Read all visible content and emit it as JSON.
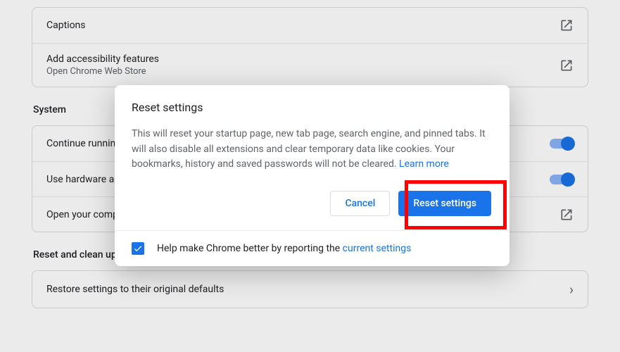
{
  "accessibility": {
    "captions_label": "Captions",
    "addfeat_label": "Add accessibility features",
    "addfeat_sub": "Open Chrome Web Store"
  },
  "system": {
    "section_title": "System",
    "continue_label": "Continue running background apps when Chrome is closed",
    "hardware_label": "Use hardware acceleration when available",
    "proxy_label": "Open your computer's proxy settings"
  },
  "reset": {
    "section_title": "Reset and clean up",
    "restore_label": "Restore settings to their original defaults"
  },
  "dialog": {
    "title": "Reset settings",
    "body": "This will reset your startup page, new tab page, search engine, and pinned tabs. It will also disable all extensions and clear temporary data like cookies. Your bookmarks, history and saved passwords will not be cleared. ",
    "learn_more": "Learn more",
    "cancel": "Cancel",
    "confirm": "Reset settings",
    "footer_pre": "Help make Chrome better by reporting the ",
    "footer_link": "current settings"
  }
}
